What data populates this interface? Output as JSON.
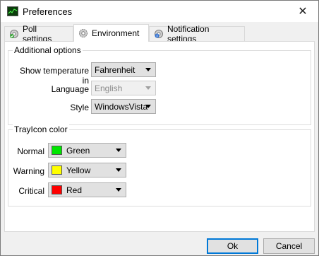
{
  "window": {
    "title": "Preferences",
    "close_glyph": "✕"
  },
  "tabs": [
    {
      "label": "Poll settings",
      "icon": "check-gear-icon"
    },
    {
      "label": "Environment",
      "icon": "gear-icon",
      "active": true
    },
    {
      "label": "Notification settings",
      "icon": "info-gear-icon"
    }
  ],
  "additional_options": {
    "title": "Additional options",
    "show_temperature_label": "Show temperature in",
    "show_temperature_value": "Fahrenheit",
    "language_label": "Language",
    "language_value": "English",
    "style_label": "Style",
    "style_value": "WindowsVista"
  },
  "trayicon_color": {
    "title": "TrayIcon color",
    "normal_label": "Normal",
    "normal_value": "Green",
    "normal_color": "#00e600",
    "warning_label": "Warning",
    "warning_value": "Yellow",
    "warning_color": "#ffff00",
    "critical_label": "Critical",
    "critical_value": "Red",
    "critical_color": "#ff0000"
  },
  "buttons": {
    "ok": "Ok",
    "cancel": "Cancel"
  },
  "colors": {
    "accent": "#0078d7"
  }
}
